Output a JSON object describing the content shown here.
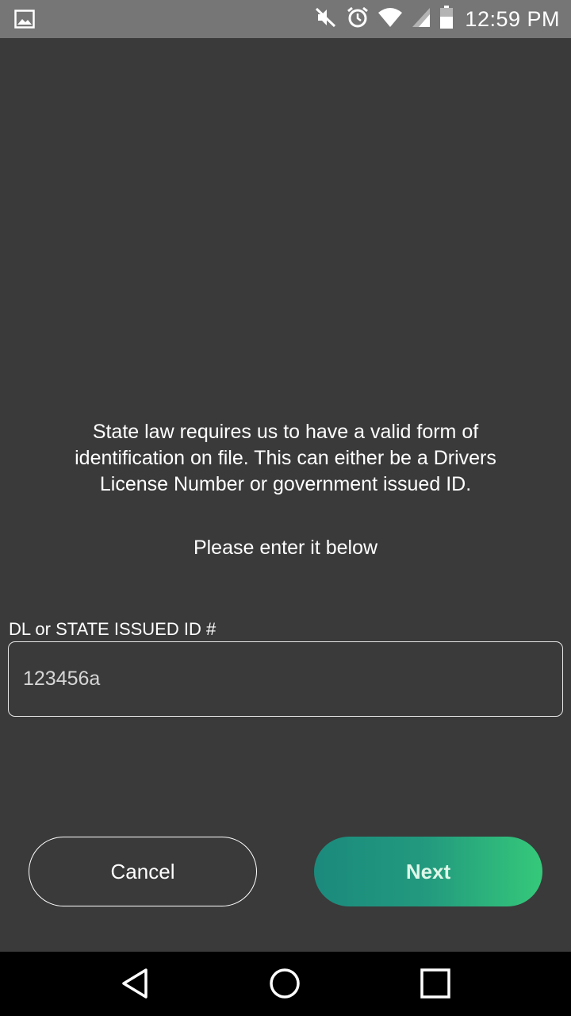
{
  "status_bar": {
    "time": "12:59 PM",
    "icons": [
      "image-icon",
      "muted-icon",
      "alarm-icon",
      "wifi-icon",
      "signal-icon",
      "battery-icon"
    ]
  },
  "content": {
    "intro_text": "State law requires us to have a valid form of identification on file. This can either be a Drivers License Number or government issued ID.",
    "prompt_text": "Please enter it below",
    "id_field": {
      "label": "DL or STATE ISSUED ID #",
      "value": "123456a"
    },
    "buttons": {
      "cancel_label": "Cancel",
      "next_label": "Next"
    }
  },
  "nav_bar": {
    "icons": [
      "back-icon",
      "home-icon",
      "recents-icon"
    ]
  },
  "colors": {
    "background": "#3a3a3a",
    "status_bar": "#767676",
    "next_gradient_start": "#1b8a7d",
    "next_gradient_end": "#35c97a"
  }
}
